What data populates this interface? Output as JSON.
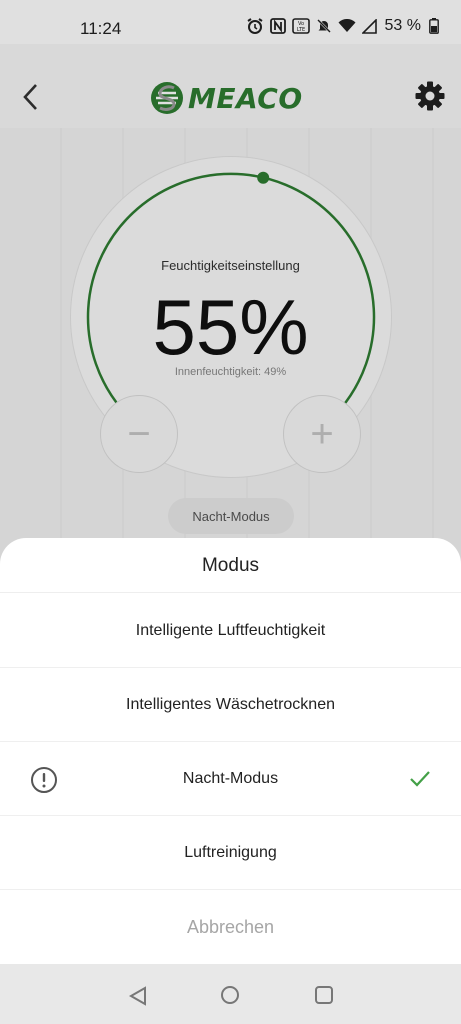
{
  "status_bar": {
    "time": "11:24",
    "battery_text": "53 %",
    "icons": [
      "alarm-icon",
      "nfc-icon",
      "volte-icon",
      "mute-icon",
      "wifi-icon",
      "signal-icon",
      "battery-icon"
    ]
  },
  "header": {
    "logo_text": "MEACO",
    "brand_color": "#2e7d32"
  },
  "humidity": {
    "label": "Feuchtigkeitseinstellung",
    "value": "55%",
    "indoor": "Innenfeuchtigkeit: 49%",
    "setpoint_fraction": 0.55
  },
  "controls": {
    "minus": "−",
    "plus": "+"
  },
  "current_mode": "Nacht-Modus",
  "sheet": {
    "title": "Modus",
    "options": [
      {
        "label": "Intelligente Luftfeuchtigkeit"
      },
      {
        "label": "Intelligentes Wäschetrocknen"
      },
      {
        "label": "Nacht-Modus",
        "selected": true
      },
      {
        "label": "Luftreinigung"
      }
    ],
    "cancel": "Abbrechen"
  },
  "colors": {
    "accent": "#2e7d32",
    "check": "#43a047"
  }
}
